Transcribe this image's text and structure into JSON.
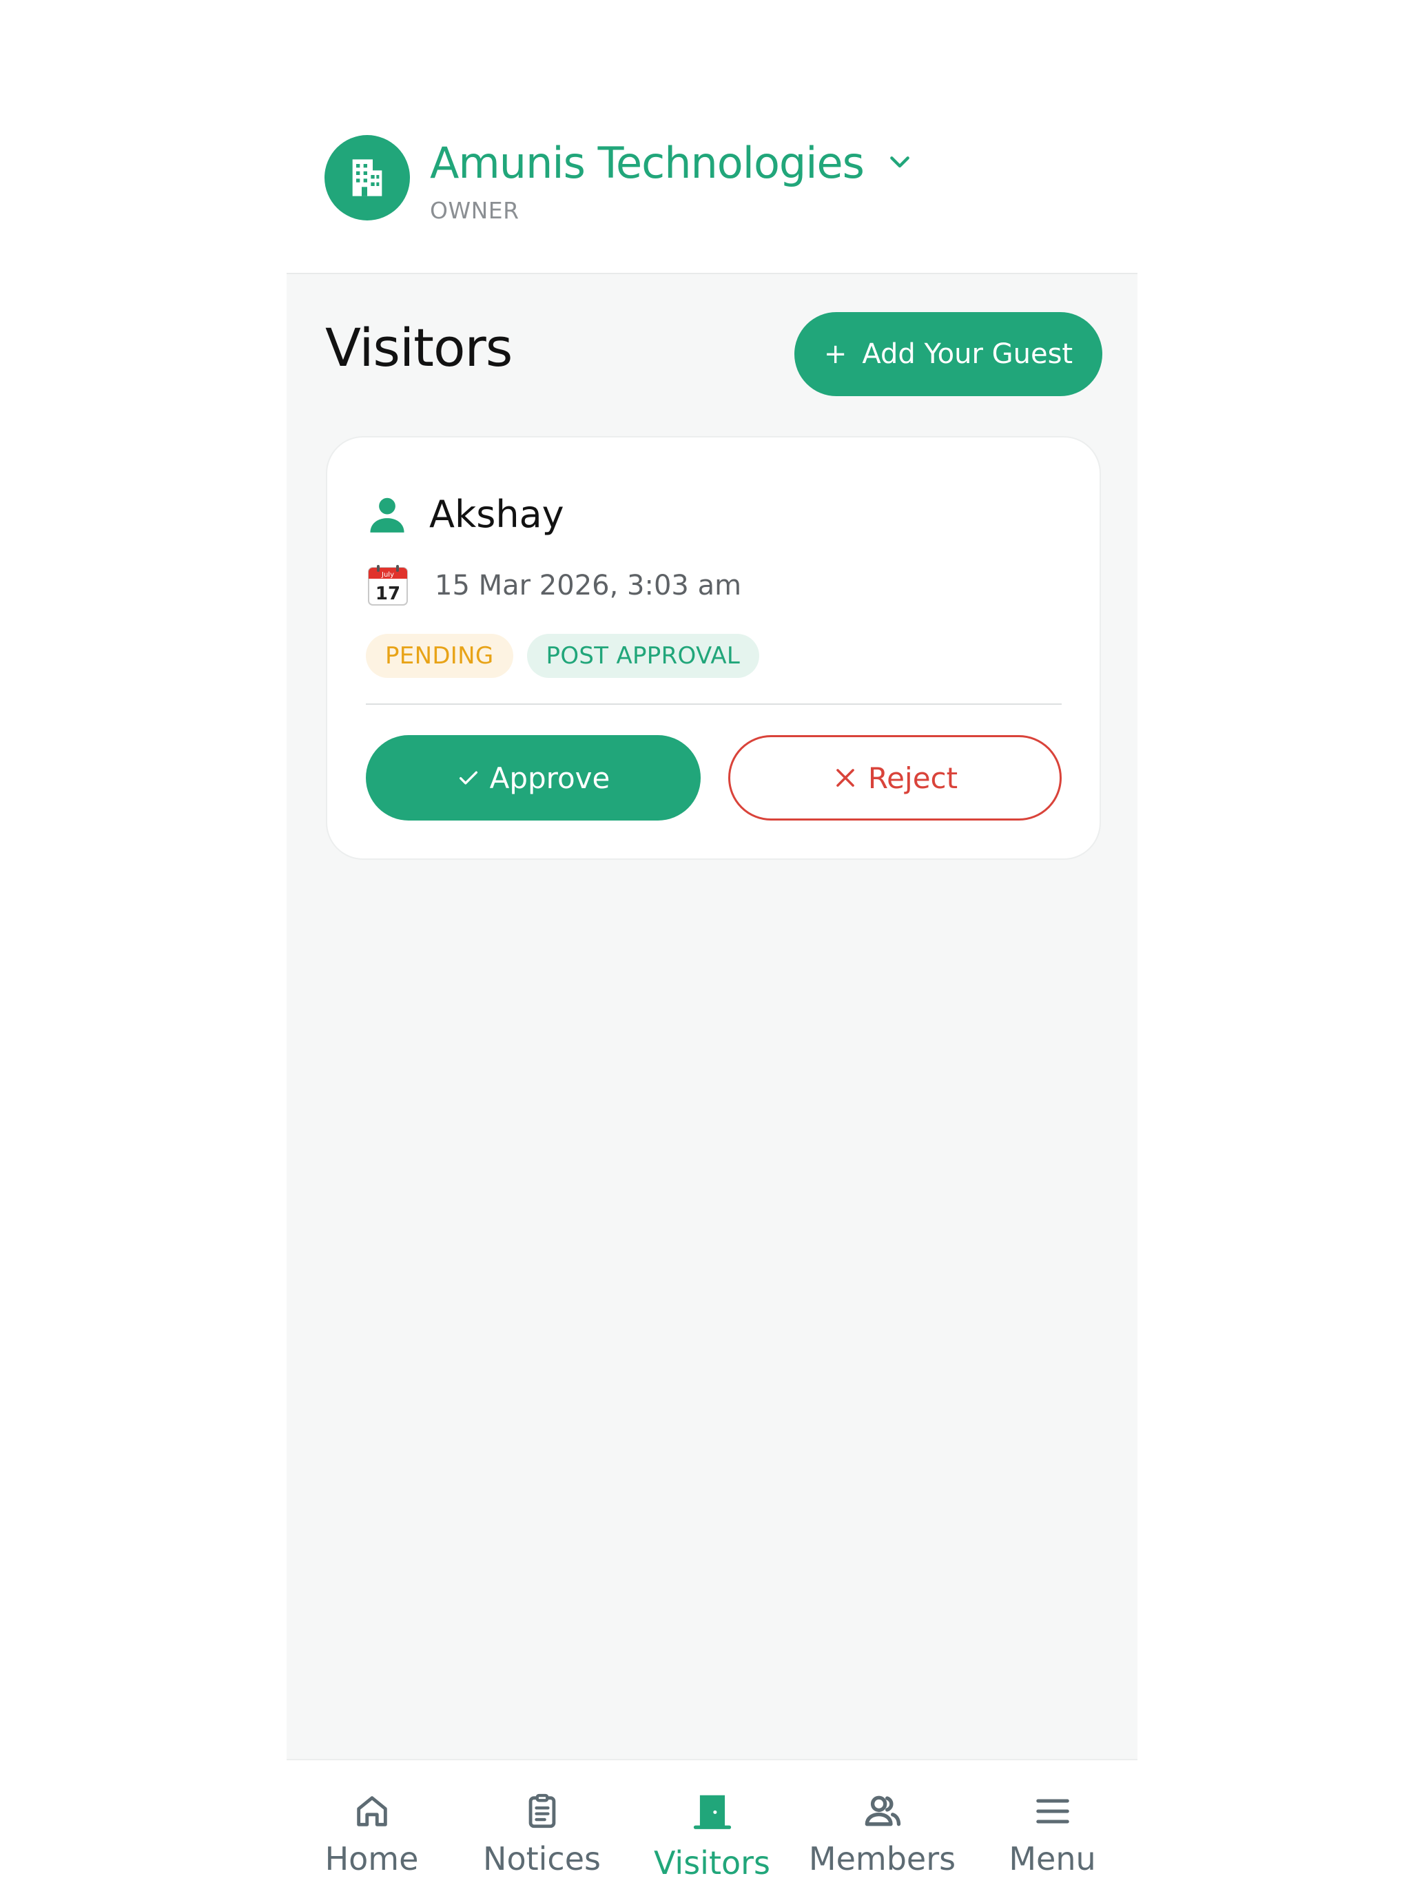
{
  "header": {
    "org_name": "Amunis Technologies",
    "role": "OWNER",
    "avatar_icon": "building-icon",
    "dropdown_icon": "chevron-down-icon"
  },
  "page": {
    "title": "Visitors",
    "add_guest_label": "Add Your Guest",
    "add_guest_icon": "plus-icon"
  },
  "visitors": [
    {
      "name": "Akshay",
      "datetime": "15 Mar 2026, 3:03 am",
      "calendar_icon": {
        "month": "July",
        "day": "17"
      },
      "badges": [
        "PENDING",
        "POST APPROVAL"
      ],
      "approve_label": "Approve",
      "reject_label": "Reject"
    }
  ],
  "bottom_nav": {
    "items": [
      {
        "label": "Home",
        "icon": "home-icon"
      },
      {
        "label": "Notices",
        "icon": "clipboard-icon"
      },
      {
        "label": "Visitors",
        "icon": "door-icon",
        "active": true
      },
      {
        "label": "Members",
        "icon": "members-icon"
      },
      {
        "label": "Menu",
        "icon": "hamburger-icon"
      }
    ]
  },
  "colors": {
    "brand": "#21a67a",
    "danger": "#d9433a",
    "pending": "#e8a317",
    "background": "#f6f7f7"
  }
}
